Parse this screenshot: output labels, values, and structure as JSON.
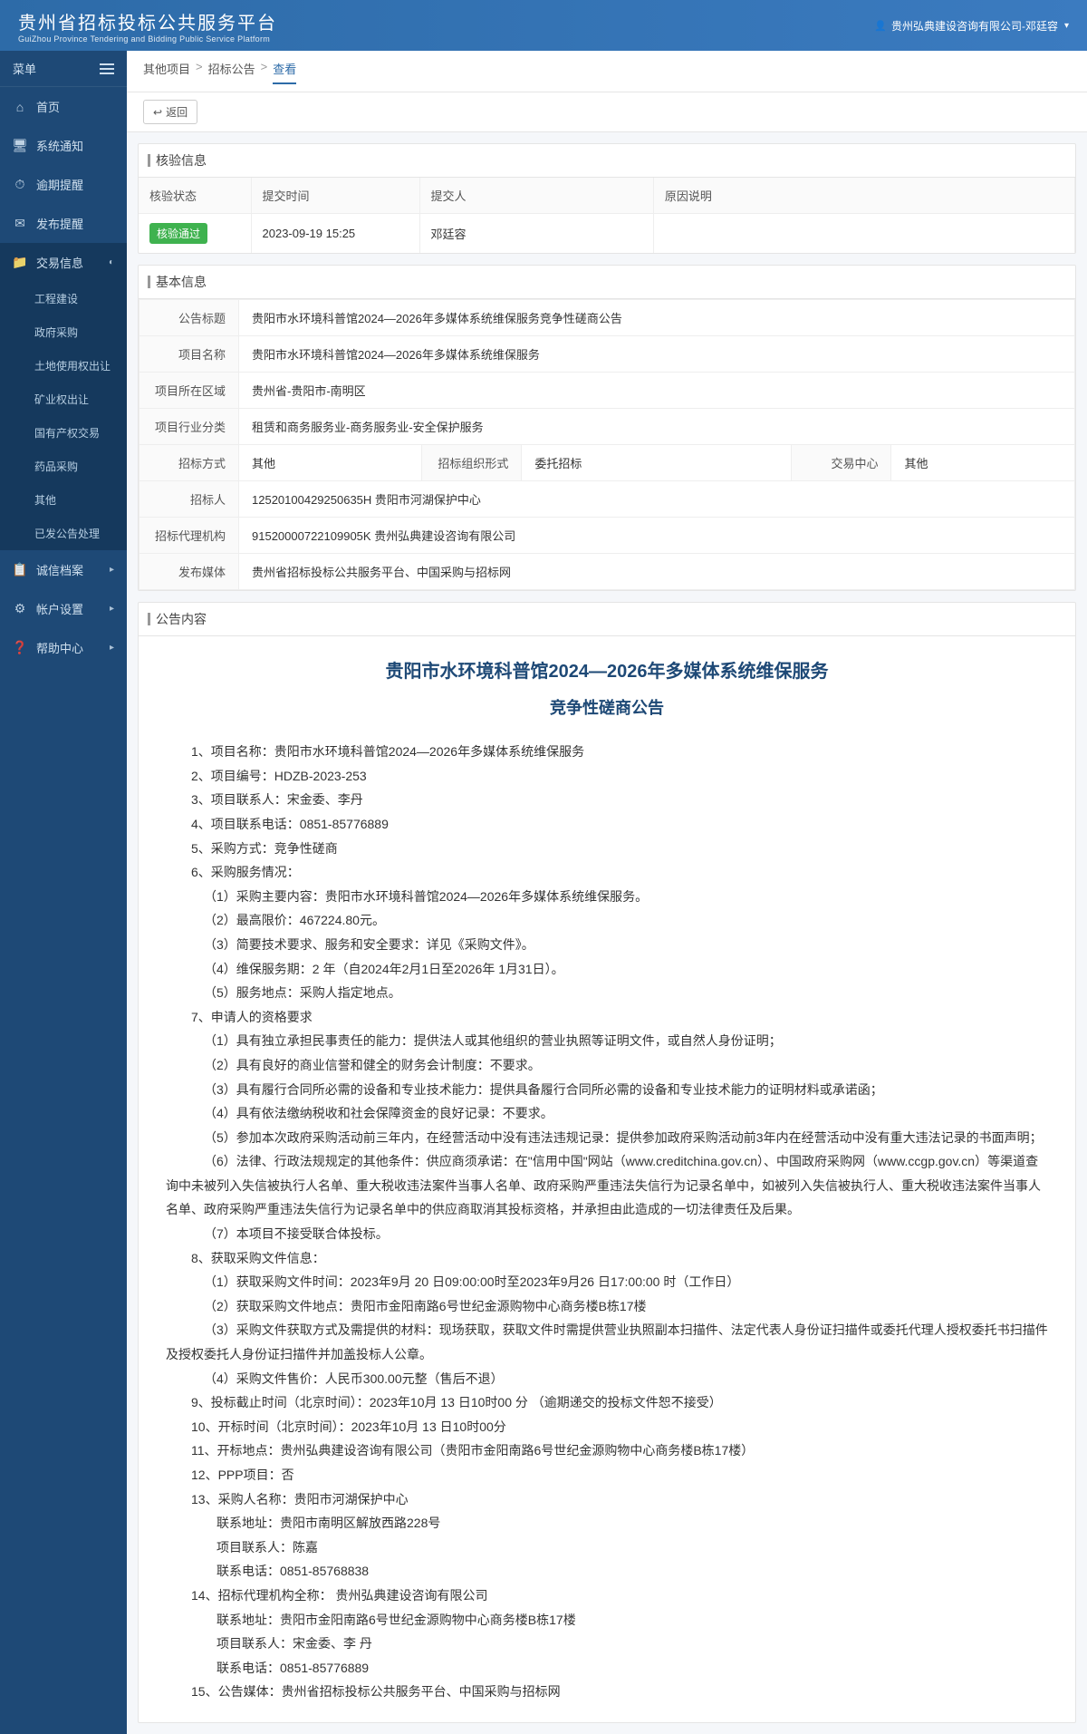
{
  "header": {
    "title": "贵州省招标投标公共服务平台",
    "subtitle": "GuiZhou Province Tendering and Bidding Public Service Platform",
    "user": "贵州弘典建设咨询有限公司-邓廷容"
  },
  "sidebar": {
    "label": "菜单",
    "items": [
      {
        "label": "首页"
      },
      {
        "label": "系统通知"
      },
      {
        "label": "逾期提醒"
      },
      {
        "label": "发布提醒"
      },
      {
        "label": "交易信息",
        "active": true,
        "children": [
          {
            "label": "工程建设"
          },
          {
            "label": "政府采购"
          },
          {
            "label": "土地使用权出让"
          },
          {
            "label": "矿业权出让"
          },
          {
            "label": "国有产权交易"
          },
          {
            "label": "药品采购"
          },
          {
            "label": "其他"
          },
          {
            "label": "已发公告处理"
          }
        ]
      },
      {
        "label": "诚信档案"
      },
      {
        "label": "帐户设置"
      },
      {
        "label": "帮助中心"
      }
    ]
  },
  "breadcrumb": {
    "items": [
      "其他项目",
      "招标公告",
      "查看"
    ],
    "back": "返回"
  },
  "verification": {
    "title": "核验信息",
    "headers": {
      "status": "核验状态",
      "submitTime": "提交时间",
      "submitter": "提交人",
      "reason": "原因说明"
    },
    "row": {
      "status": "核验通过",
      "submitTime": "2023-09-19 15:25",
      "submitter": "邓廷容",
      "reason": ""
    }
  },
  "basic": {
    "title": "基本信息",
    "labels": {
      "annTitle": "公告标题",
      "projName": "项目名称",
      "region": "项目所在区域",
      "industry": "项目行业分类",
      "method": "招标方式",
      "orgForm": "招标组织形式",
      "center": "交易中心",
      "tenderer": "招标人",
      "agency": "招标代理机构",
      "media": "发布媒体"
    },
    "values": {
      "annTitle": "贵阳市水环境科普馆2024—2026年多媒体系统维保服务竞争性磋商公告",
      "projName": "贵阳市水环境科普馆2024—2026年多媒体系统维保服务",
      "region": "贵州省-贵阳市-南明区",
      "industry": "租赁和商务服务业-商务服务业-安全保护服务",
      "method": "其他",
      "orgForm": "委托招标",
      "center": "其他",
      "tenderer": "12520100429250635H 贵阳市河湖保护中心",
      "agency": "91520000722109905K 贵州弘典建设咨询有限公司",
      "media": "贵州省招标投标公共服务平台、中国采购与招标网"
    }
  },
  "announcement": {
    "title": "公告内容",
    "docTitle": "贵阳市水环境科普馆2024—2026年多媒体系统维保服务",
    "docSubtitle": "竞争性磋商公告",
    "body": [
      {
        "t": "1、项目名称：贵阳市水环境科普馆2024—2026年多媒体系统维保服务",
        "c": "indent0"
      },
      {
        "t": "2、项目编号：HDZB-2023-253",
        "c": "indent0"
      },
      {
        "t": "3、项目联系人：宋金委、李丹",
        "c": "indent0"
      },
      {
        "t": "4、项目联系电话：0851-85776889",
        "c": "indent0"
      },
      {
        "t": "5、采购方式：竞争性磋商",
        "c": "indent0"
      },
      {
        "t": "6、采购服务情况：",
        "c": "indent0"
      },
      {
        "t": "（1）采购主要内容：贵阳市水环境科普馆2024—2026年多媒体系统维保服务。",
        "c": "sub1"
      },
      {
        "t": "（2）最高限价：467224.80元。",
        "c": "sub1"
      },
      {
        "t": "（3）简要技术要求、服务和安全要求：详见《采购文件》。",
        "c": "sub1"
      },
      {
        "t": "（4）维保服务期：2  年（自2024年2月1日至2026年 1月31日）。",
        "c": "sub1"
      },
      {
        "t": "（5）服务地点：采购人指定地点。",
        "c": "sub1"
      },
      {
        "t": "7、申请人的资格要求",
        "c": "indent0"
      },
      {
        "t": "（1）具有独立承担民事责任的能力：提供法人或其他组织的营业执照等证明文件，或自然人身份证明；",
        "c": "sub1"
      },
      {
        "t": "（2）具有良好的商业信誉和健全的财务会计制度：不要求。",
        "c": "sub1"
      },
      {
        "t": "（3）具有履行合同所必需的设备和专业技术能力：提供具备履行合同所必需的设备和专业技术能力的证明材料或承诺函；",
        "c": "sub1"
      },
      {
        "t": "（4）具有依法缴纳税收和社会保障资金的良好记录：不要求。",
        "c": "sub1"
      },
      {
        "t": "（5）参加本次政府采购活动前三年内，在经营活动中没有违法违规记录：提供参加政府采购活动前3年内在经营活动中没有重大违法记录的书面声明；",
        "c": "sub1"
      },
      {
        "t": "（6）法律、行政法规规定的其他条件：供应商须承诺：在\"信用中国\"网站（www.creditchina.gov.cn）、中国政府采购网（www.ccgp.gov.cn）等渠道查询中未被列入失信被执行人名单、重大税收违法案件当事人名单、政府采购严重违法失信行为记录名单中，如被列入失信被执行人、重大税收违法案件当事人名单、政府采购严重违法失信行为记录名单中的供应商取消其投标资格，并承担由此造成的一切法律责任及后果。",
        "c": "sub1"
      },
      {
        "t": "（7）本项目不接受联合体投标。",
        "c": "sub1"
      },
      {
        "t": "8、获取采购文件信息：",
        "c": "indent0"
      },
      {
        "t": "（1）获取采购文件时间：2023年9月  20 日09:00:00时至2023年9月26 日17:00:00 时（工作日）",
        "c": "sub1"
      },
      {
        "t": "（2）获取采购文件地点：贵阳市金阳南路6号世纪金源购物中心商务楼B栋17楼",
        "c": "sub1"
      },
      {
        "t": "（3）采购文件获取方式及需提供的材料：现场获取，获取文件时需提供营业执照副本扫描件、法定代表人身份证扫描件或委托代理人授权委托书扫描件及授权委托人身份证扫描件并加盖投标人公章。",
        "c": "sub1"
      },
      {
        "t": "（4）采购文件售价：人民币300.00元整（售后不退）",
        "c": "sub1"
      },
      {
        "t": "9、投标截止时间（北京时间）：2023年10月  13 日10时00 分    （逾期递交的投标文件恕不接受）",
        "c": "indent0"
      },
      {
        "t": "10、开标时间（北京时间）：2023年10月  13 日10时00分",
        "c": "indent0"
      },
      {
        "t": "11、开标地点：贵州弘典建设咨询有限公司（贵阳市金阳南路6号世纪金源购物中心商务楼B栋17楼）",
        "c": "indent0"
      },
      {
        "t": "12、PPP项目：否",
        "c": "indent0"
      },
      {
        "t": "13、采购人名称：贵阳市河湖保护中心",
        "c": "indent0"
      },
      {
        "t": "联系地址：贵阳市南明区解放西路228号",
        "c": "sub2"
      },
      {
        "t": "项目联系人：陈嘉",
        "c": "sub2"
      },
      {
        "t": "联系电话：0851-85768838",
        "c": "sub2"
      },
      {
        "t": "14、招标代理机构全称：  贵州弘典建设咨询有限公司",
        "c": "indent0"
      },
      {
        "t": "联系地址：贵阳市金阳南路6号世纪金源购物中心商务楼B栋17楼",
        "c": "sub2"
      },
      {
        "t": "项目联系人：宋金委、李 丹",
        "c": "sub2"
      },
      {
        "t": "联系电话：0851-85776889",
        "c": "sub2"
      },
      {
        "t": "15、公告媒体：贵州省招标投标公共服务平台、中国采购与招标网",
        "c": "indent0"
      }
    ]
  }
}
